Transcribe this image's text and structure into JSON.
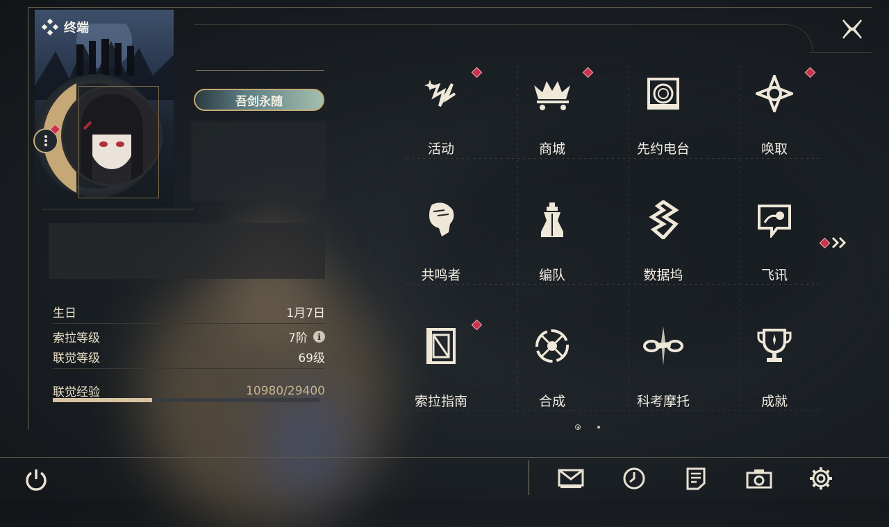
{
  "header": {
    "terminal_label": "终端"
  },
  "profile": {
    "title_plate": "吾剑永随"
  },
  "stats": {
    "birthday_label": "生日",
    "birthday_value": "1月7日",
    "sola_level_label": "索拉等级",
    "sola_level_value": "7阶",
    "union_level_label": "联觉等级",
    "union_level_value": "69级",
    "union_exp_label": "联觉经验",
    "union_exp_value": "10980/29400",
    "union_exp_fraction": 0.3735
  },
  "grid": {
    "items": [
      {
        "label": "活动",
        "icon": "activity-icon",
        "badge": true
      },
      {
        "label": "商城",
        "icon": "shop-icon",
        "badge": true
      },
      {
        "label": "先约电台",
        "icon": "radio-icon",
        "badge": false
      },
      {
        "label": "唤取",
        "icon": "convene-icon",
        "badge": true
      },
      {
        "label": "共鸣者",
        "icon": "resonator-icon",
        "badge": false
      },
      {
        "label": "编队",
        "icon": "team-icon",
        "badge": false
      },
      {
        "label": "数据坞",
        "icon": "data-bank-icon",
        "badge": false
      },
      {
        "label": "飞讯",
        "icon": "message-icon",
        "badge": false
      },
      {
        "label": "索拉指南",
        "icon": "guidebook-icon",
        "badge": true
      },
      {
        "label": "合成",
        "icon": "synthesis-icon",
        "badge": false
      },
      {
        "label": "科考摩托",
        "icon": "motorcycle-icon",
        "badge": false
      },
      {
        "label": "成就",
        "icon": "trophy-icon",
        "badge": false
      }
    ]
  },
  "pager": {
    "current": 1,
    "total": 2
  },
  "colors": {
    "accent_gold": "#c6a876",
    "badge_red": "#c8324a",
    "text_light": "#f1ece0"
  }
}
